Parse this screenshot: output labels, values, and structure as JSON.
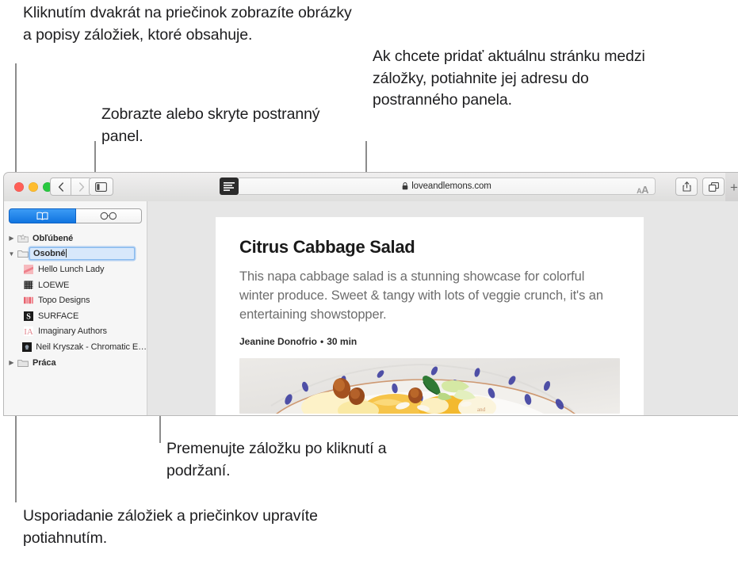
{
  "callouts": {
    "folder": "Kliknutím dvakrát na priečinok zobrazíte obrázky a popisy záložiek, ktoré obsahuje.",
    "sidebar": "Zobrazte alebo skryte postranný panel.",
    "address": "Ak chcete pridať aktuálnu stránku medzi záložky, potiahnite jej adresu do postranného panela.",
    "rename": "Premenujte záložku po kliknutí a podržaní.",
    "reorder": "Usporiadanie záložiek a priečinkov upravíte potiahnutím."
  },
  "window": {
    "toolbar": {
      "traffic_lights": [
        "close",
        "minimize",
        "maximize"
      ],
      "back_label": "‹",
      "forward_label": "›",
      "sidebar_toggle_name": "sidebar-toggle-icon",
      "reader_name": "reader-view-icon",
      "share_name": "share-icon",
      "tabs_name": "show-tabs-icon",
      "newtab_label": "+",
      "url": "loveandlemons.com",
      "lock_name": "lock-icon",
      "textsize_small": "A",
      "textsize_large": "A"
    },
    "sidebar": {
      "tabs": [
        {
          "name": "bookmarks",
          "icon": "book-icon",
          "selected": true
        },
        {
          "name": "reading-list",
          "icon": "glasses-icon",
          "selected": false
        }
      ],
      "items": [
        {
          "label": "Obľúbené",
          "type": "folder",
          "expanded": false,
          "level": 0
        },
        {
          "label": "Osobné",
          "type": "folder",
          "expanded": true,
          "level": 0,
          "editing": true
        },
        {
          "label": "Hello Lunch Lady",
          "type": "bookmark",
          "level": 1,
          "favicon": "hello-lunch-lady"
        },
        {
          "label": "LOEWE",
          "type": "bookmark",
          "level": 1,
          "favicon": "loewe"
        },
        {
          "label": "Topo Designs",
          "type": "bookmark",
          "level": 1,
          "favicon": "topo-designs"
        },
        {
          "label": "SURFACE",
          "type": "bookmark",
          "level": 1,
          "favicon": "surface"
        },
        {
          "label": "Imaginary Authors",
          "type": "bookmark",
          "level": 1,
          "favicon": "imaginary-authors"
        },
        {
          "label": "Neil Kryszak - Chromatic E…",
          "type": "bookmark",
          "level": 1,
          "favicon": "neil-kryszak"
        },
        {
          "label": "Práca",
          "type": "folder",
          "expanded": false,
          "level": 0
        }
      ]
    },
    "article": {
      "title": "Citrus Cabbage Salad",
      "description": "This napa cabbage salad is a stunning showcase for colorful winter produce. Sweet & tangy with lots of veggie crunch, it's an entertaining showstopper.",
      "author": "Jeanine Donofrio",
      "separator": "•",
      "duration": "30 min",
      "hero_image_alt": "citrus-cabbage-salad-photo"
    }
  },
  "colors": {
    "accent_blue": "#1074e0",
    "selection_blue": "#d8e8fb",
    "leader_line": "#8c8c8c",
    "text": "#1d1d1f",
    "muted_text": "#6d6d6d"
  }
}
